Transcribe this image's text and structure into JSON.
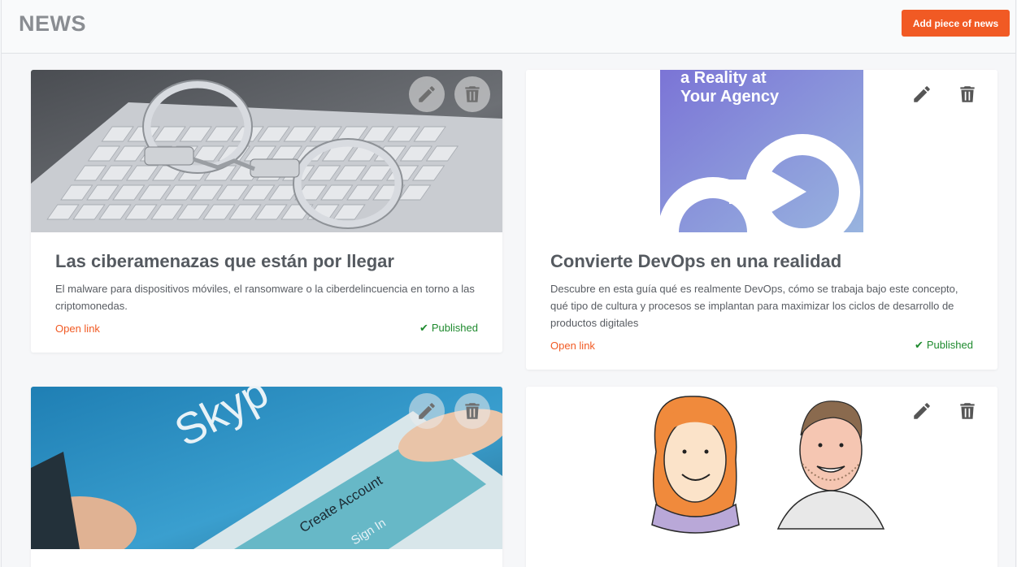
{
  "header": {
    "title": "NEWS",
    "add_button_label": "Add piece of news",
    "accent_color": "#f15a24"
  },
  "news": [
    {
      "title": "Las ciberamenazas que están por llegar",
      "description": "El malware para dispositivos móviles, el ransomware o la ciberdelincuencia en torno a las criptomonedas.",
      "link_label": "Open link",
      "status": "Published",
      "image_subject": "handcuffs on keyboard photo"
    },
    {
      "title": "Convierte DevOps en una realidad",
      "description": "Descubre en esta guía qué es realmente DevOps, cómo se trabaja bajo este concepto, qué tipo de cultura y procesos se implantan para maximizar los ciclos de desarrollo de productos digitales",
      "link_label": "Open link",
      "status": "Published",
      "image_subject": "devops guide cover",
      "image_text": [
        "a Reality at",
        "Your Agency"
      ]
    },
    {
      "image_subject": "skype on phone photo",
      "image_text": [
        "Skyp",
        "Create Account",
        "Sign In"
      ]
    },
    {
      "image_subject": "illustrated portraits"
    }
  ],
  "icons": {
    "edit": "pencil-icon",
    "delete": "trash-icon",
    "status": "check-icon"
  },
  "status_color": "#1e8a2e"
}
